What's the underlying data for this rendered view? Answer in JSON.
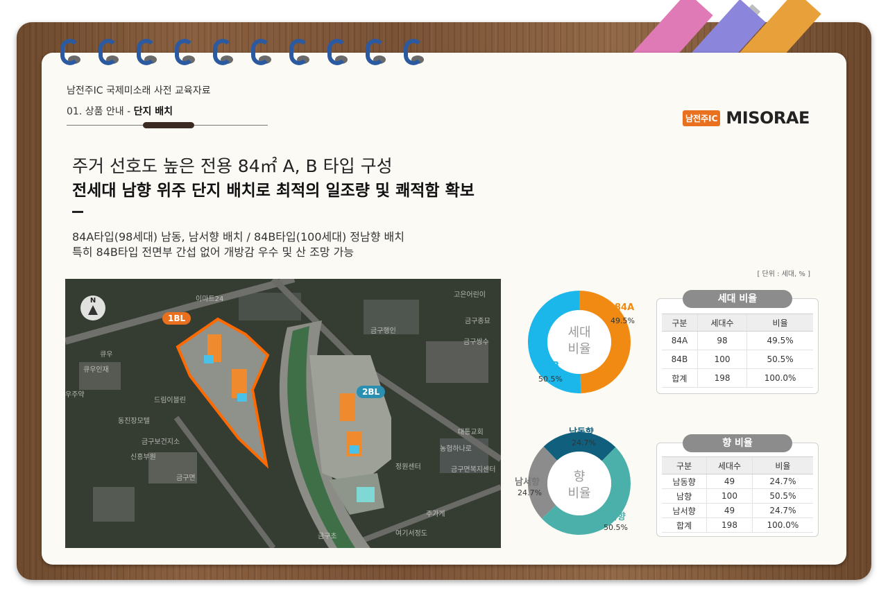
{
  "header": {
    "doc_title": "남전주IC 국제미소래 사전 교육자료",
    "section_prefix": "01. 상품 안내 -",
    "section_current": "단지 배치",
    "brand_tag": "남전주IC",
    "brand_name": "MISORAE"
  },
  "headline": {
    "line1": "주거 선호도 높은 전용 84㎡ A, B 타입 구성",
    "line2": "전세대 남향 위주 단지 배치로 최적의 일조량 및 쾌적함 확보"
  },
  "description": {
    "line1": "84A타입(98세대) 남동, 남서향 배치 / 84B타입(100세대) 정남향 배치",
    "line2": "특히 84B타입 전면부 간섭 없어 개방감 우수 및 산 조망 가능"
  },
  "unit_note": "[ 단위 : 세대, % ]",
  "map": {
    "compass": "N",
    "block1": "1BL",
    "block2": "2BL",
    "labels": [
      "이마트24",
      "고은어린이",
      "금구종묘",
      "금구쌍수",
      "동진장모텔",
      "드림이블린",
      "우주약",
      "금구보건지소",
      "대통교회",
      "농협하나로",
      "금구면복지센터",
      "정원센터",
      "여기서정도",
      "금구초",
      "금구행인",
      "금구면",
      "주가게",
      "신흥부원",
      "큐우인재",
      "큐우"
    ]
  },
  "colors": {
    "orange": "#f18a13",
    "sky": "#1bb6ea",
    "teal_dark": "#0f5f7d",
    "teal": "#4bb0aa",
    "grey": "#8c8c8c"
  },
  "chart_data": [
    {
      "type": "pie",
      "center_label_1": "세대",
      "center_label_2": "비율",
      "categories": [
        "84A",
        "84B"
      ],
      "values": [
        49.5,
        50.5
      ],
      "percent_labels": [
        "49.5%",
        "50.5%"
      ],
      "colors": [
        "#f18a13",
        "#1bb6ea"
      ]
    },
    {
      "type": "pie",
      "center_label_1": "향",
      "center_label_2": "비율",
      "categories": [
        "남동향",
        "정남향",
        "남서향"
      ],
      "values": [
        24.7,
        50.5,
        24.7
      ],
      "percent_labels": [
        "24.7%",
        "50.5%",
        "24.7%"
      ],
      "colors": [
        "#0f5f7d",
        "#4bb0aa",
        "#8c8c8c"
      ]
    }
  ],
  "table1": {
    "title": "세대 비율",
    "headers": [
      "구분",
      "세대수",
      "비율"
    ],
    "rows": [
      [
        "84A",
        "98",
        "49.5%"
      ],
      [
        "84B",
        "100",
        "50.5%"
      ],
      [
        "합계",
        "198",
        "100.0%"
      ]
    ]
  },
  "table2": {
    "title": "향 비율",
    "headers": [
      "구분",
      "세대수",
      "비율"
    ],
    "rows": [
      [
        "남동향",
        "49",
        "24.7%"
      ],
      [
        "남향",
        "100",
        "50.5%"
      ],
      [
        "남서향",
        "49",
        "24.7%"
      ],
      [
        "합계",
        "198",
        "100.0%"
      ]
    ]
  }
}
